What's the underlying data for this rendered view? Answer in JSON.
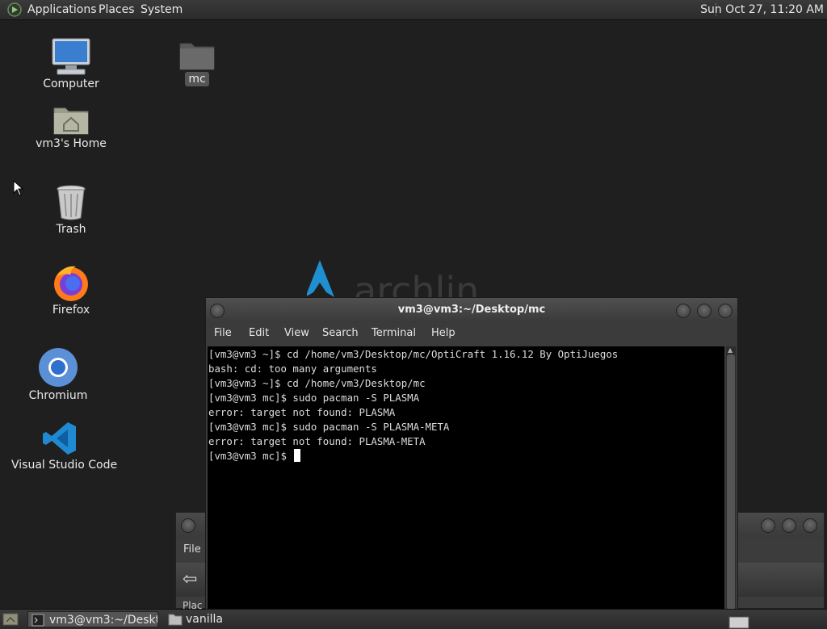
{
  "topbar": {
    "menus": [
      "Applications",
      "Places",
      "System"
    ],
    "clock": "Sun Oct 27, 11:20 AM"
  },
  "desktop": {
    "icons": [
      {
        "label": "Computer",
        "icon": "computer-icon"
      },
      {
        "label": "vm3's Home",
        "icon": "home-folder-icon"
      },
      {
        "label": "Trash",
        "icon": "trash-icon"
      },
      {
        "label": "Firefox",
        "icon": "firefox-icon"
      },
      {
        "label": "Chromium",
        "icon": "chromium-icon"
      },
      {
        "label": "Visual Studio Code",
        "icon": "vscode-icon"
      },
      {
        "label": "mc",
        "icon": "folder-icon"
      }
    ]
  },
  "back_window": {
    "menu_file": "File",
    "places_label": "Plac"
  },
  "terminal": {
    "title": "vm3@vm3:~/Desktop/mc",
    "menu": [
      "File",
      "Edit",
      "View",
      "Search",
      "Terminal",
      "Help"
    ],
    "lines": [
      "[vm3@vm3 ~]$ cd /home/vm3/Desktop/mc/OptiCraft 1.16.12 By OptiJuegos",
      "bash: cd: too many arguments",
      "[vm3@vm3 ~]$ cd /home/vm3/Desktop/mc",
      "[vm3@vm3 mc]$ sudo pacman -S PLASMA",
      "error: target not found: PLASMA",
      "[vm3@vm3 mc]$ sudo pacman -S PLASMA-META",
      "error: target not found: PLASMA-META",
      "[vm3@vm3 mc]$ "
    ]
  },
  "taskbar": {
    "tasks": [
      {
        "label": "vm3@vm3:~/Deskt...",
        "icon": "terminal-icon"
      },
      {
        "label": "vanilla",
        "icon": "folder-icon"
      }
    ]
  }
}
